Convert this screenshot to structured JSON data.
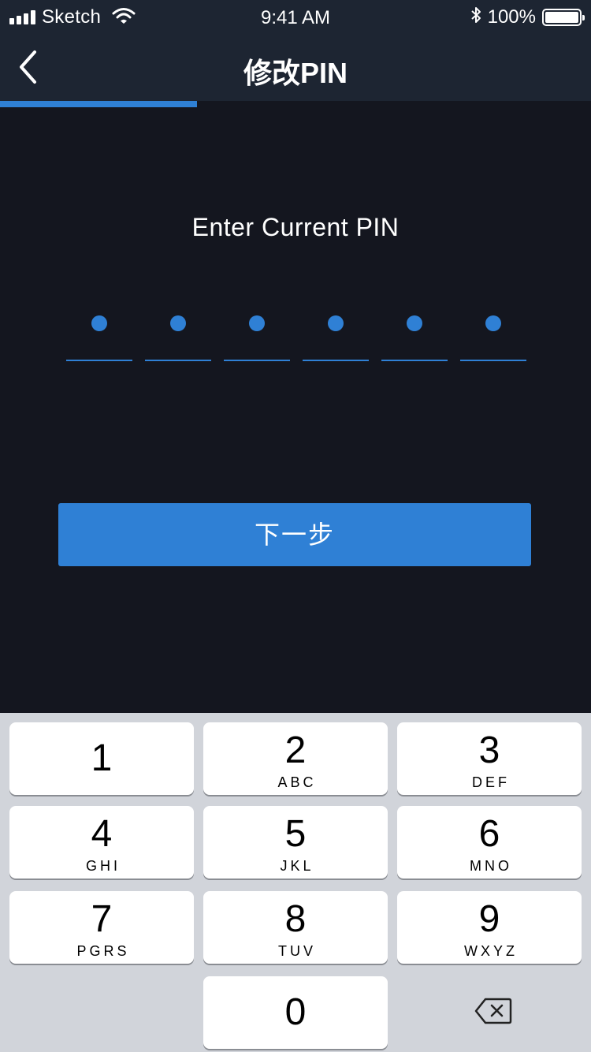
{
  "status_bar": {
    "carrier": "Sketch",
    "time": "9:41 AM",
    "battery_percent": "100%",
    "icons": [
      "signal-icon",
      "wifi-icon",
      "bluetooth-icon",
      "battery-icon"
    ]
  },
  "nav": {
    "title": "修改PIN",
    "back_icon": "chevron-left-icon"
  },
  "progress": {
    "value": 0.333
  },
  "prompt": "Enter Current PIN",
  "pin": {
    "length": 6,
    "filled": 6
  },
  "next_button": "下一步",
  "keypad": {
    "keys": [
      {
        "digit": "1",
        "letters": ""
      },
      {
        "digit": "2",
        "letters": "ABC"
      },
      {
        "digit": "3",
        "letters": "DEF"
      },
      {
        "digit": "4",
        "letters": "GHI"
      },
      {
        "digit": "5",
        "letters": "JKL"
      },
      {
        "digit": "6",
        "letters": "MNO"
      },
      {
        "digit": "7",
        "letters": "PGRS"
      },
      {
        "digit": "8",
        "letters": "TUV"
      },
      {
        "digit": "9",
        "letters": "WXYZ"
      },
      {
        "digit": "0",
        "letters": ""
      }
    ],
    "delete_icon": "backspace-icon"
  },
  "colors": {
    "background": "#14161f",
    "header": "#1d2532",
    "accent": "#2f80d5",
    "keypad_bg": "#d1d4da"
  }
}
